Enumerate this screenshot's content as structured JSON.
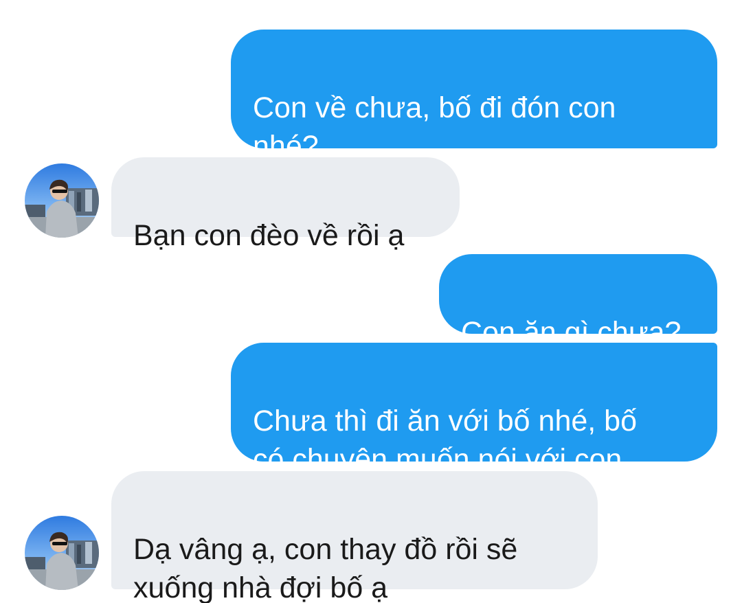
{
  "conversation": {
    "messages": [
      {
        "sender": "outgoing",
        "text": "Con về chưa, bố đi đón con\nnhé?"
      },
      {
        "sender": "incoming",
        "text": "Bạn con đèo về rồi ạ"
      },
      {
        "sender": "outgoing",
        "text": "Con ăn gì chưa?"
      },
      {
        "sender": "outgoing",
        "text": "Chưa thì đi ăn với bố nhé, bố\ncó chuyện muốn nói với con"
      },
      {
        "sender": "incoming",
        "text": "Dạ vâng ạ, con thay đồ rồi sẽ\nxuống nhà đợi bố ạ"
      }
    ]
  },
  "contact": {
    "avatar_icon": "profile-photo-avatar"
  },
  "colors": {
    "outgoing_bubble": "#1f9bf0",
    "incoming_bubble": "#eaedf1",
    "outgoing_text": "#ffffff",
    "incoming_text": "#1a1a1a"
  }
}
